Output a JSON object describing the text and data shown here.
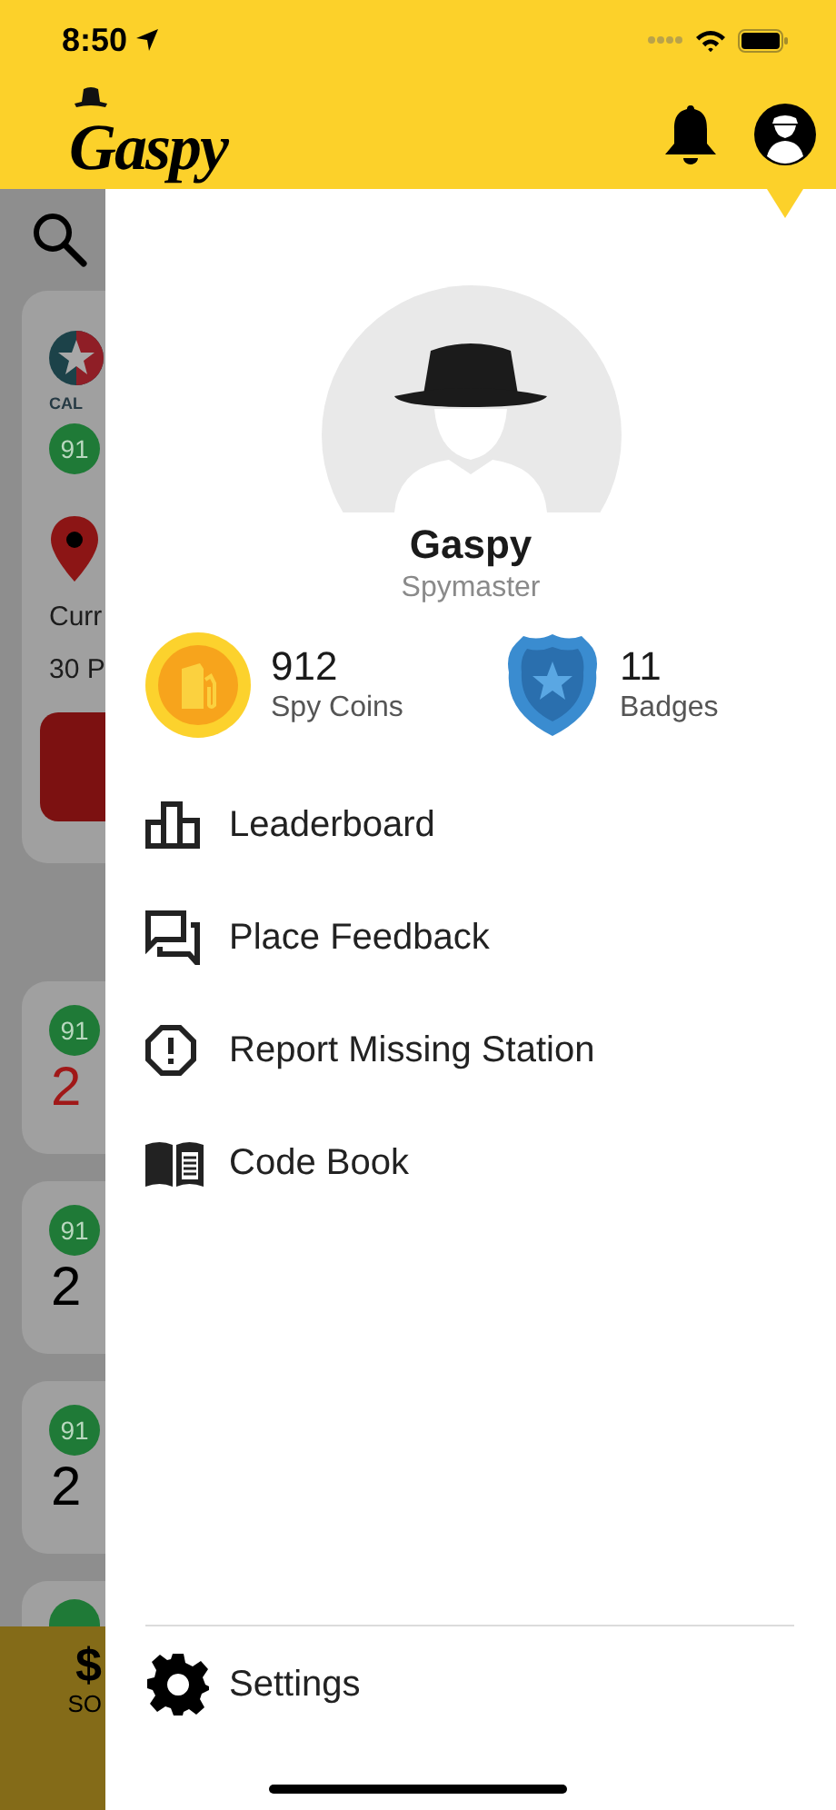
{
  "status_bar": {
    "time": "8:50"
  },
  "header": {
    "logo": "Gaspy"
  },
  "background": {
    "cards": [
      {
        "kind": "station",
        "brand": "CAL",
        "grade": "91",
        "location": "Curr",
        "distance": "30 P"
      },
      {
        "kind": "price",
        "grade": "91",
        "price": "2",
        "color": "#a01818"
      },
      {
        "kind": "price",
        "grade": "91",
        "price": "2",
        "color": "#000000"
      },
      {
        "kind": "price",
        "grade": "91",
        "price": "2",
        "color": "#000000"
      },
      {
        "kind": "partial"
      }
    ],
    "bottom_bar": {
      "price": "$",
      "label": "SO"
    }
  },
  "drawer": {
    "profile": {
      "name": "Gaspy",
      "rank": "Spymaster"
    },
    "stats": [
      {
        "kind": "coins",
        "value": "912",
        "label": "Spy Coins"
      },
      {
        "kind": "badges",
        "value": "11",
        "label": "Badges"
      }
    ],
    "menu": [
      {
        "kind": "leaderboard",
        "label": "Leaderboard"
      },
      {
        "kind": "feedback",
        "label": "Place Feedback"
      },
      {
        "kind": "report",
        "label": "Report Missing Station"
      },
      {
        "kind": "book",
        "label": "Code Book"
      }
    ],
    "settings": {
      "label": "Settings"
    }
  }
}
